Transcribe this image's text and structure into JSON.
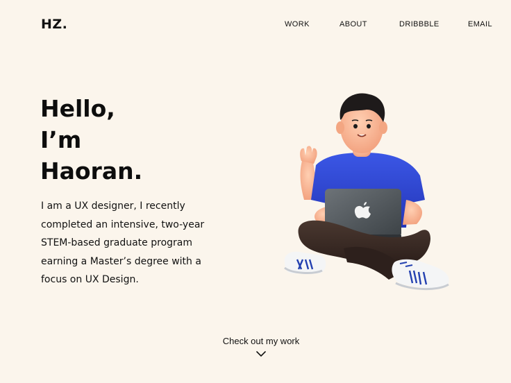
{
  "header": {
    "logo": "HZ.",
    "nav": [
      {
        "label": "WORK"
      },
      {
        "label": "ABOUT"
      },
      {
        "label": "DRIBBBLE"
      },
      {
        "label": "EMAIL"
      }
    ]
  },
  "hero": {
    "headline_lines": [
      "Hello,",
      "I’m",
      "Haoran."
    ],
    "intro_lines": [
      "I am a UX designer, I recently",
      "completed an intensive, two-year",
      "STEM-based graduate program",
      "earning a Master’s degree with a",
      "focus on UX Design."
    ],
    "illustration": "3d-avatar-with-laptop-illustration"
  },
  "cta": {
    "label": "Check out my work",
    "icon": "chevron-down-icon"
  },
  "colors": {
    "background": "#fbf5ec",
    "text": "#111111",
    "shirt": "#2f49d6",
    "pants": "#3a2a24"
  }
}
